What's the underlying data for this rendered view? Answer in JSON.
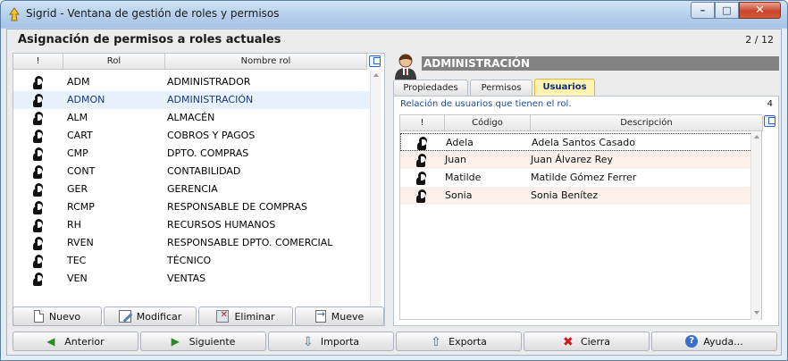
{
  "window": {
    "title": "Sigrid - Ventana de gestión de roles y permisos",
    "minimize_glyph": "–",
    "maximize_glyph": "□",
    "close_glyph": "✕"
  },
  "header": {
    "title": "Asignación de permisos a roles actuales",
    "page_count": "2 / 12"
  },
  "roles_grid": {
    "columns": [
      "!",
      "Rol",
      "Nombre rol"
    ],
    "selected_index": 1,
    "rows": [
      {
        "code": "ADM",
        "name": "ADMINISTRADOR"
      },
      {
        "code": "ADMON",
        "name": "ADMINISTRACIÓN"
      },
      {
        "code": "ALM",
        "name": "ALMACÉN"
      },
      {
        "code": "CART",
        "name": "COBROS Y PAGOS"
      },
      {
        "code": "CMP",
        "name": "DPTO. COMPRAS"
      },
      {
        "code": "CONT",
        "name": "CONTABILIDAD"
      },
      {
        "code": "GER",
        "name": "GERENCIA"
      },
      {
        "code": "RCMP",
        "name": "RESPONSABLE DE COMPRAS"
      },
      {
        "code": "RH",
        "name": "RECURSOS HUMANOS"
      },
      {
        "code": "RVEN",
        "name": "RESPONSABLE DPTO. COMERCIAL"
      },
      {
        "code": "TEC",
        "name": "TÉCNICO"
      },
      {
        "code": "VEN",
        "name": "VENTAS"
      }
    ]
  },
  "role_actions": {
    "new_label": "Nuevo",
    "modify_label": "Modificar",
    "delete_label": "Eliminar",
    "move_label": "Mueve"
  },
  "detail": {
    "role_title": "ADMINISTRACIÓN",
    "tabs": [
      "Propiedades",
      "Permisos",
      "Usuarios"
    ],
    "active_tab": "Usuarios",
    "relation_label": "Relación de usuarios que tienen el rol.",
    "relation_count": "4",
    "users_columns": [
      "!",
      "Código",
      "Descripción"
    ],
    "users": [
      {
        "code": "Adela",
        "description": "Adela Santos Casado"
      },
      {
        "code": "Juan",
        "description": "Juan Álvarez Rey"
      },
      {
        "code": "Matilde",
        "description": "Matilde Gómez Ferrer"
      },
      {
        "code": "Sonia",
        "description": "Sonia Benítez"
      }
    ]
  },
  "bottom_actions": {
    "previous_label": "Anterior",
    "next_label": "Siguiente",
    "import_label": "Importa",
    "export_label": "Exporta",
    "close_label": "Cierra",
    "help_label": "Ayuda..."
  },
  "colors": {
    "selected_row": "#e6f1fb",
    "active_tab": "#fff3b0",
    "role_title_bg": "#828282",
    "alt_row": "#fbf0ea"
  },
  "icons": [
    "app-icon",
    "person-icon",
    "external-link-icon",
    "new-document-icon",
    "edit-icon",
    "delete-icon",
    "move-icon",
    "arrow-left-icon",
    "arrow-right-icon",
    "import-icon",
    "export-icon",
    "close-icon",
    "help-icon"
  ]
}
